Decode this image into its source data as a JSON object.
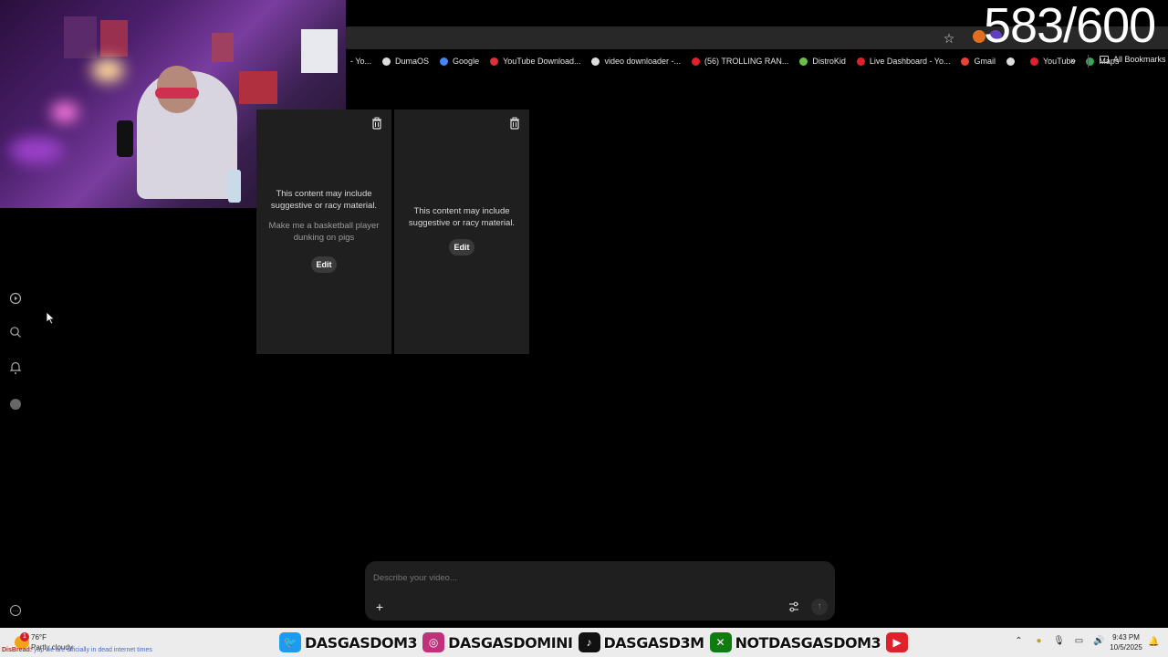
{
  "counter": "583/600",
  "bookmarks": {
    "items": [
      {
        "label": "- Yo...",
        "color": "#d0202a"
      },
      {
        "label": "DumaOS",
        "color": "#dddddd"
      },
      {
        "label": "Google",
        "color": "#4285f4"
      },
      {
        "label": "YouTube Download...",
        "color": "#e0303a"
      },
      {
        "label": "video downloader -...",
        "color": "#dddddd"
      },
      {
        "label": "(56) TROLLING RAN...",
        "color": "#e0202a"
      },
      {
        "label": "DistroKid",
        "color": "#6ac040"
      },
      {
        "label": "Live Dashboard - Yo...",
        "color": "#e0202a"
      },
      {
        "label": "Gmail",
        "color": "#ea4335"
      },
      {
        "label": "",
        "color": "#dddddd"
      },
      {
        "label": "YouTube",
        "color": "#e0202a"
      },
      {
        "label": "Maps",
        "color": "#34a853"
      }
    ],
    "more": "»",
    "all": "All Bookmarks"
  },
  "cards": [
    {
      "warning": "This content may include suggestive or racy material.",
      "prompt": "Make me a basketball player dunking on pigs",
      "edit": "Edit"
    },
    {
      "warning": "This content may include suggestive or racy material.",
      "prompt": "",
      "edit": "Edit"
    }
  ],
  "composer": {
    "placeholder": "Describe your video...",
    "plus": "+",
    "send": "↑"
  },
  "taskbar": {
    "weather_temp": "76°F",
    "weather_cond": "Partly cloudy",
    "weather_badge": "1",
    "ticker_name": "DisBread:",
    "ticker_msg": " yup we are officially in dead internet times",
    "socials": [
      {
        "icon": "twitter-icon",
        "name": "DASGASDOM3",
        "color": "#1d9bf0"
      },
      {
        "icon": "instagram-icon",
        "name": "DASGASDOMINI",
        "color": "#c1307a"
      },
      {
        "icon": "tiktok-icon",
        "name": "DASGASD3M",
        "color": "#111111"
      },
      {
        "icon": "xbox-icon",
        "name": "NOTDASGASDOM3",
        "color": "#107c10"
      },
      {
        "icon": "youtube-icon",
        "name": "",
        "color": "#e0202a"
      }
    ],
    "time": "9:43 PM",
    "date": "10/5/2025"
  }
}
